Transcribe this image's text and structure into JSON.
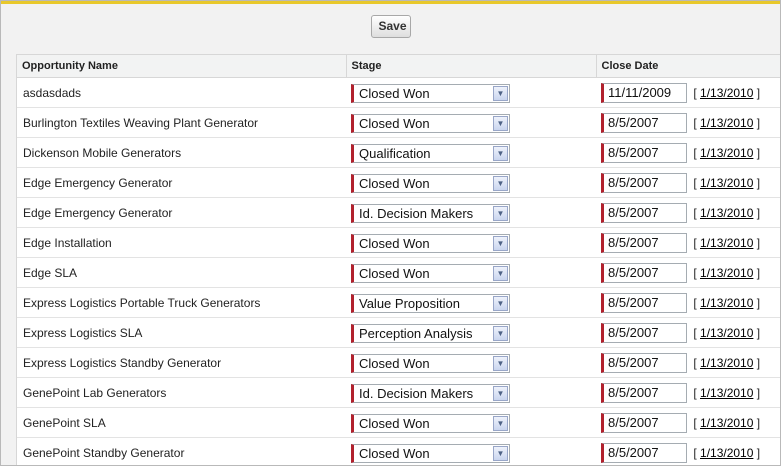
{
  "toolbar": {
    "save_label": "Save"
  },
  "table": {
    "headers": {
      "name": "Opportunity Name",
      "stage": "Stage",
      "close_date": "Close Date"
    },
    "today_link": "1/13/2010",
    "rows": [
      {
        "name": "asdasdads",
        "stage": "Closed Won",
        "close_date": "11/11/2009"
      },
      {
        "name": "Burlington Textiles Weaving Plant Generator",
        "stage": "Closed Won",
        "close_date": "8/5/2007"
      },
      {
        "name": "Dickenson Mobile Generators",
        "stage": "Qualification",
        "close_date": "8/5/2007"
      },
      {
        "name": "Edge Emergency Generator",
        "stage": "Closed Won",
        "close_date": "8/5/2007"
      },
      {
        "name": "Edge Emergency Generator",
        "stage": "Id. Decision Makers",
        "close_date": "8/5/2007"
      },
      {
        "name": "Edge Installation",
        "stage": "Closed Won",
        "close_date": "8/5/2007"
      },
      {
        "name": "Edge SLA",
        "stage": "Closed Won",
        "close_date": "8/5/2007"
      },
      {
        "name": "Express Logistics Portable Truck Generators",
        "stage": "Value Proposition",
        "close_date": "8/5/2007"
      },
      {
        "name": "Express Logistics SLA",
        "stage": "Perception Analysis",
        "close_date": "8/5/2007"
      },
      {
        "name": "Express Logistics Standby Generator",
        "stage": "Closed Won",
        "close_date": "8/5/2007"
      },
      {
        "name": "GenePoint Lab Generators",
        "stage": "Id. Decision Makers",
        "close_date": "8/5/2007"
      },
      {
        "name": "GenePoint SLA",
        "stage": "Closed Won",
        "close_date": "8/5/2007"
      },
      {
        "name": "GenePoint Standby Generator",
        "stage": "Closed Won",
        "close_date": "8/5/2007"
      }
    ]
  },
  "colors": {
    "accent_bar": "#e8c82b",
    "required_marker": "#b1212d",
    "header_bg": "#f2f3f3"
  },
  "icons": {
    "dropdown": "chevron-down-icon"
  }
}
